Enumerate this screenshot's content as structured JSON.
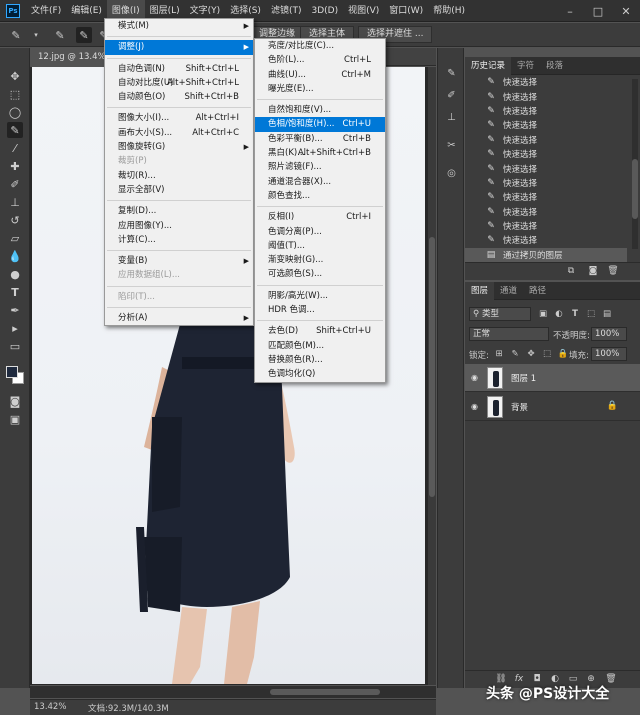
{
  "menubar": {
    "logo": "Ps",
    "items": [
      "文件(F)",
      "编辑(E)",
      "图像(I)",
      "图层(L)",
      "文字(Y)",
      "选择(S)",
      "滤镜(T)",
      "3D(D)",
      "视图(V)",
      "窗口(W)",
      "帮助(H)"
    ],
    "active_index": 2
  },
  "options": {
    "button1_partial": "调整边缘",
    "select_subject": "选择主体",
    "select_mask": "选择并遮住 ..."
  },
  "document": {
    "tab": "12.jpg @ 13.4% (图层",
    "zoom": "13.42%",
    "docinfo": "文档:92.3M/140.3M"
  },
  "image_menu": [
    {
      "label": "模式(M)",
      "sub": true
    },
    {
      "sep": true
    },
    {
      "label": "调整(J)",
      "sub": true,
      "hl": true
    },
    {
      "sep": true
    },
    {
      "label": "自动色调(N)",
      "sc": "Shift+Ctrl+L"
    },
    {
      "label": "自动对比度(U)",
      "sc": "Alt+Shift+Ctrl+L"
    },
    {
      "label": "自动颜色(O)",
      "sc": "Shift+Ctrl+B"
    },
    {
      "sep": true
    },
    {
      "label": "图像大小(I)...",
      "sc": "Alt+Ctrl+I"
    },
    {
      "label": "画布大小(S)...",
      "sc": "Alt+Ctrl+C"
    },
    {
      "label": "图像旋转(G)",
      "sub": true
    },
    {
      "label": "裁剪(P)",
      "dis": true
    },
    {
      "label": "裁切(R)..."
    },
    {
      "label": "显示全部(V)"
    },
    {
      "sep": true
    },
    {
      "label": "复制(D)..."
    },
    {
      "label": "应用图像(Y)..."
    },
    {
      "label": "计算(C)..."
    },
    {
      "sep": true
    },
    {
      "label": "变量(B)",
      "sub": true
    },
    {
      "label": "应用数据组(L)...",
      "dis": true
    },
    {
      "sep": true
    },
    {
      "label": "陷印(T)...",
      "dis": true
    },
    {
      "sep": true
    },
    {
      "label": "分析(A)",
      "sub": true
    }
  ],
  "adjust_menu": [
    {
      "label": "亮度/对比度(C)..."
    },
    {
      "label": "色阶(L)...",
      "sc": "Ctrl+L"
    },
    {
      "label": "曲线(U)...",
      "sc": "Ctrl+M"
    },
    {
      "label": "曝光度(E)..."
    },
    {
      "sep": true
    },
    {
      "label": "自然饱和度(V)..."
    },
    {
      "label": "色相/饱和度(H)...",
      "sc": "Ctrl+U",
      "hl": true
    },
    {
      "label": "色彩平衡(B)...",
      "sc": "Ctrl+B"
    },
    {
      "label": "黑白(K)...",
      "sc": "Alt+Shift+Ctrl+B"
    },
    {
      "label": "照片滤镜(F)..."
    },
    {
      "label": "通道混合器(X)..."
    },
    {
      "label": "颜色查找..."
    },
    {
      "sep": true
    },
    {
      "label": "反相(I)",
      "sc": "Ctrl+I"
    },
    {
      "label": "色调分离(P)..."
    },
    {
      "label": "阈值(T)..."
    },
    {
      "label": "渐变映射(G)..."
    },
    {
      "label": "可选颜色(S)..."
    },
    {
      "sep": true
    },
    {
      "label": "阴影/高光(W)..."
    },
    {
      "label": "HDR 色调..."
    },
    {
      "sep": true
    },
    {
      "label": "去色(D)",
      "sc": "Shift+Ctrl+U"
    },
    {
      "label": "匹配颜色(M)..."
    },
    {
      "label": "替换颜色(R)..."
    },
    {
      "label": "色调均化(Q)"
    }
  ],
  "history": {
    "tabs": [
      "历史记录",
      "字符",
      "段落"
    ],
    "items": [
      "快速选择",
      "快速选择",
      "快速选择",
      "快速选择",
      "快速选择",
      "快速选择",
      "快速选择",
      "快速选择",
      "快速选择",
      "快速选择",
      "快速选择",
      "快速选择"
    ],
    "last": "通过拷贝的图层"
  },
  "layers": {
    "tabs": [
      "图层",
      "通道",
      "路径"
    ],
    "kind": "类型",
    "blend": "正常",
    "opacity_label": "不透明度:",
    "opacity": "100%",
    "lock_label": "锁定:",
    "fill_label": "填充:",
    "fill": "100%",
    "items": [
      {
        "name": "图层 1"
      },
      {
        "name": "背景"
      }
    ]
  },
  "watermark": "头条 @PS设计大全",
  "colors": {
    "accent": "#0078d7",
    "foreground": "#1f2a3e"
  }
}
